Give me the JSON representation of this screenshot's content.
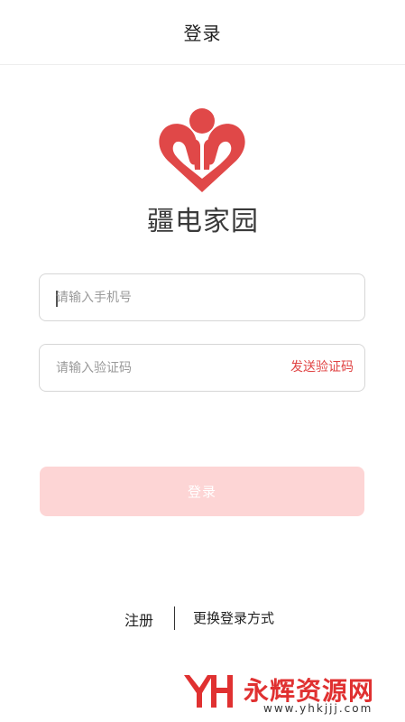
{
  "header": {
    "title": "登录"
  },
  "logo": {
    "icon": "heart-people-logo",
    "text": "疆电家园",
    "color": "#e04848"
  },
  "form": {
    "phone": {
      "placeholder": "请输入手机号",
      "value": ""
    },
    "code": {
      "placeholder": "请输入验证码",
      "value": "",
      "send_label": "发送验证码"
    },
    "login_label": "登录",
    "login_color": "#fdd5d5"
  },
  "links": {
    "register": "注册",
    "switch_method": "更换登录方式"
  },
  "watermark": {
    "title": "永辉资源网",
    "url": "www.yhkjjj.com",
    "color": "#e03131"
  }
}
